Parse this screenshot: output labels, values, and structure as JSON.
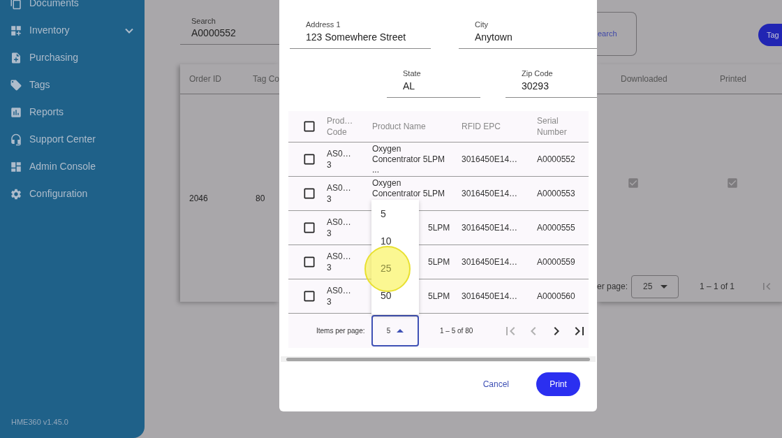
{
  "sidebar": {
    "items": [
      {
        "label": "Documents",
        "kind": "link"
      },
      {
        "label": "Inventory",
        "kind": "group"
      },
      {
        "label": "Purchasing",
        "kind": "link"
      },
      {
        "label": "Tags",
        "kind": "link"
      },
      {
        "label": "Reports",
        "kind": "link"
      },
      {
        "label": "Support Center",
        "kind": "link"
      },
      {
        "label": "Admin Console",
        "kind": "link"
      },
      {
        "label": "Configuration",
        "kind": "link"
      }
    ],
    "version": "HME360 v1.45.0"
  },
  "search": {
    "label": "Search",
    "value": "A0000552"
  },
  "search_button": {
    "label": "earch"
  },
  "tags_button": {
    "label": "Tag"
  },
  "orders_table": {
    "columns": [
      "Order ID",
      "Tag Co",
      "Downloaded",
      "Printed"
    ],
    "row": {
      "order_id": "2046",
      "tag_count": "80",
      "downloaded": true,
      "printed": true
    },
    "footer": {
      "items_per_page_label": "er page:",
      "items_per_page": "25",
      "range": "1 – 1 of 1"
    }
  },
  "dialog": {
    "fields": [
      {
        "label": "Address 1",
        "value": "123 Somewhere Street"
      },
      {
        "label": "City",
        "value": "Anytown"
      },
      {
        "label": "State",
        "value": "AL"
      },
      {
        "label": "Zip Code",
        "value": "30293"
      }
    ],
    "table": {
      "select_all": {
        "checked": false
      },
      "columns": [
        "Prod…\nCode",
        "Product Name",
        "RFID EPC",
        "Serial\nNumber"
      ],
      "rows": [
        {
          "checked": false,
          "product_code": "AS0…\n3",
          "product_name": "Oxygen\nConcentrator 5LPM\n...",
          "covered": false,
          "rfid_epc": "3016450E14…",
          "serial_number": "A0000552"
        },
        {
          "checked": false,
          "product_code": "AS0…\n3",
          "product_name": "Oxygen\nConcentrator 5LPM",
          "covered": false,
          "rfid_epc": "3016450E14…",
          "serial_number": "A0000553"
        },
        {
          "checked": false,
          "product_code": "AS0…\n3",
          "product_name": "5LPM",
          "covered": true,
          "rfid_epc": "3016450E14…",
          "serial_number": "A0000555"
        },
        {
          "checked": false,
          "product_code": "AS0…\n3",
          "product_name": "5LPM",
          "covered": true,
          "rfid_epc": "3016450E14…",
          "serial_number": "A0000559"
        },
        {
          "checked": false,
          "product_code": "AS0…\n3",
          "product_name": "5LPM",
          "covered": true,
          "rfid_epc": "3016450E14…",
          "serial_number": "A0000560"
        }
      ],
      "paginator": {
        "label": "Items per page:",
        "value": "5",
        "open": true,
        "range": "1 – 5 of 80",
        "first_disabled": true,
        "prev_disabled": true,
        "next_disabled": false,
        "last_disabled": false
      },
      "page_size_options": [
        {
          "label": "5",
          "pointer": false
        },
        {
          "label": "10",
          "pointer": false
        },
        {
          "label": "25",
          "pointer": true
        },
        {
          "label": "50",
          "pointer": false
        }
      ]
    },
    "buttons": {
      "cancel": "Cancel",
      "print": "Print"
    }
  }
}
